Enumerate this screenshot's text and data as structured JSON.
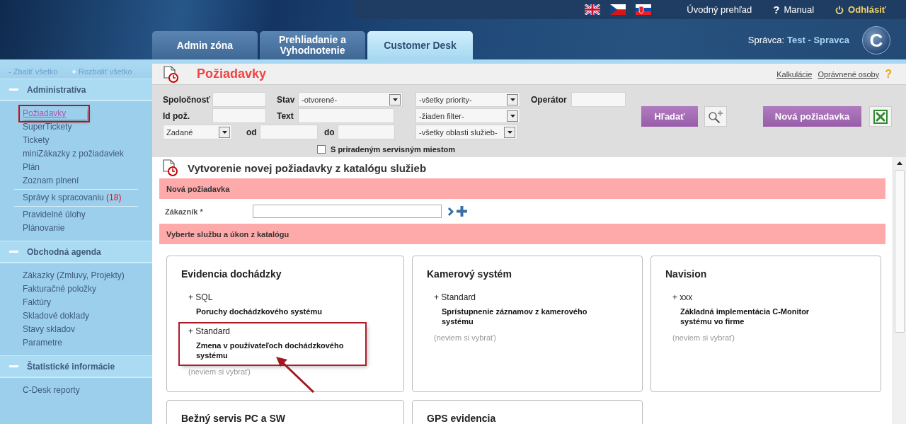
{
  "top_bar": {
    "links": [
      {
        "kind": "home",
        "label": "Úvodný prehľad"
      },
      {
        "kind": "help",
        "icon": "?",
        "label": "Manual"
      },
      {
        "kind": "logout",
        "label": "Odhlásiť"
      }
    ]
  },
  "tabs": [
    {
      "label": "Admin zóna",
      "selected": false
    },
    {
      "label": "Prehliadanie a Vyhodnotenie",
      "selected": false
    },
    {
      "label": "Customer Desk",
      "selected": true
    }
  ],
  "user": {
    "label": "Správca:",
    "name": "Test - Spravca"
  },
  "logo": {
    "letter": "C"
  },
  "sidebar": {
    "collapse": {
      "icon": "-",
      "label": "Zbaliť všetko"
    },
    "expand": {
      "icon": "+",
      "label": "Rozbaliť všetko"
    },
    "sections": [
      {
        "title": "Administratíva",
        "expanded": true,
        "groups": [
          [
            {
              "label": "Požiadavky",
              "selected": true,
              "highlighted": true
            },
            {
              "label": "SuperTickety",
              "selected": false,
              "highlighted": false
            },
            {
              "label": "Tickety",
              "selected": false,
              "highlighted": false
            },
            {
              "label": "miniZákazky z požiadaviek",
              "selected": false,
              "highlighted": false
            },
            {
              "label": "Plán",
              "selected": false,
              "highlighted": false
            },
            {
              "label": "Zoznam plnení",
              "selected": false,
              "highlighted": false
            }
          ],
          [
            {
              "label": "Správy k spracovaniu",
              "count": "(18)",
              "selected": false,
              "highlighted": false
            }
          ],
          [
            {
              "label": "Pravidelné úlohy",
              "selected": false,
              "highlighted": false
            },
            {
              "label": "Plánovanie",
              "selected": false,
              "highlighted": false
            }
          ]
        ]
      },
      {
        "title": "Obchodná agenda",
        "expanded": true,
        "groups": [
          [
            {
              "label": "Zákazky (Zmluvy, Projekty)",
              "selected": false,
              "highlighted": false
            },
            {
              "label": "Fakturačné položky",
              "selected": false,
              "highlighted": false
            },
            {
              "label": "Faktúry",
              "selected": false,
              "highlighted": false
            },
            {
              "label": "Skladové doklady",
              "selected": false,
              "highlighted": false
            },
            {
              "label": "Stavy skladov",
              "selected": false,
              "highlighted": false
            },
            {
              "label": "Parametre",
              "selected": false,
              "highlighted": false
            }
          ]
        ]
      },
      {
        "title": "Štatistické informácie",
        "expanded": true,
        "groups": [
          [
            {
              "label": "C-Desk reporty",
              "selected": false,
              "highlighted": false
            }
          ]
        ]
      }
    ]
  },
  "page": {
    "title": "Požiadavky",
    "links": [
      "Kalkulácie",
      "Oprávnené osoby"
    ],
    "help": "?"
  },
  "filters": {
    "rows": [
      {
        "fields": [
          {
            "kind": "label",
            "text": "Spoločnosť"
          },
          {
            "kind": "input"
          },
          {
            "kind": "label",
            "text": "Stav"
          },
          {
            "kind": "select",
            "value": "-otvorené-"
          },
          {
            "kind": "select",
            "value": "-všetky priority-"
          },
          {
            "kind": "label",
            "text": "Operátor"
          },
          {
            "kind": "input"
          }
        ]
      },
      {
        "fields": [
          {
            "kind": "label",
            "text": "Id pož."
          },
          {
            "kind": "input"
          },
          {
            "kind": "label",
            "text": "Text"
          },
          {
            "kind": "input"
          },
          {
            "kind": "select",
            "value": "-žiaden filter-"
          }
        ]
      },
      {
        "fields": [
          {
            "kind": "select",
            "value": "Zadané"
          },
          {
            "kind": "label",
            "text": "od"
          },
          {
            "kind": "input"
          },
          {
            "kind": "label",
            "text": "do"
          },
          {
            "kind": "input"
          },
          {
            "kind": "select",
            "value": "-všetky oblasti služieb-"
          }
        ]
      }
    ],
    "checkbox": {
      "label": "S priradeným servisným miestom",
      "checked": false
    },
    "search_button": "Hľadať",
    "new_button": "Nová požiadavka"
  },
  "create": {
    "title": "Vytvorenie novej požiadavky z katalógu služieb",
    "new_bar": "Nová požiadavka",
    "customer_label": "Zákazník *",
    "catalog_bar": "Vyberte službu a úkon z katalógu",
    "cards": [
      {
        "title": "Evidencia dochádzky",
        "options": [
          {
            "name": "+ SQL",
            "description": "Poruchy dochádzkového systému",
            "highlighted": false
          },
          {
            "name": "+ Standard",
            "description": "Zmena v používateľoch dochádzkového systému",
            "highlighted": true
          }
        ],
        "fallback": "(neviem si vybrať)"
      },
      {
        "title": "Kamerový systém",
        "options": [
          {
            "name": "+ Standard",
            "description": "Sprístupnenie záznamov z kamerového systému",
            "highlighted": false
          }
        ],
        "fallback": "(neviem si vybrať)"
      },
      {
        "title": "Navision",
        "options": [
          {
            "name": "+ xxx",
            "description": "Základná implementácia C-Monitor systému vo firme",
            "highlighted": false
          }
        ],
        "fallback": "(neviem si vybrať)"
      },
      {
        "title": "Bežný servis PC a SW"
      },
      {
        "title": "GPS evidencia"
      }
    ]
  }
}
